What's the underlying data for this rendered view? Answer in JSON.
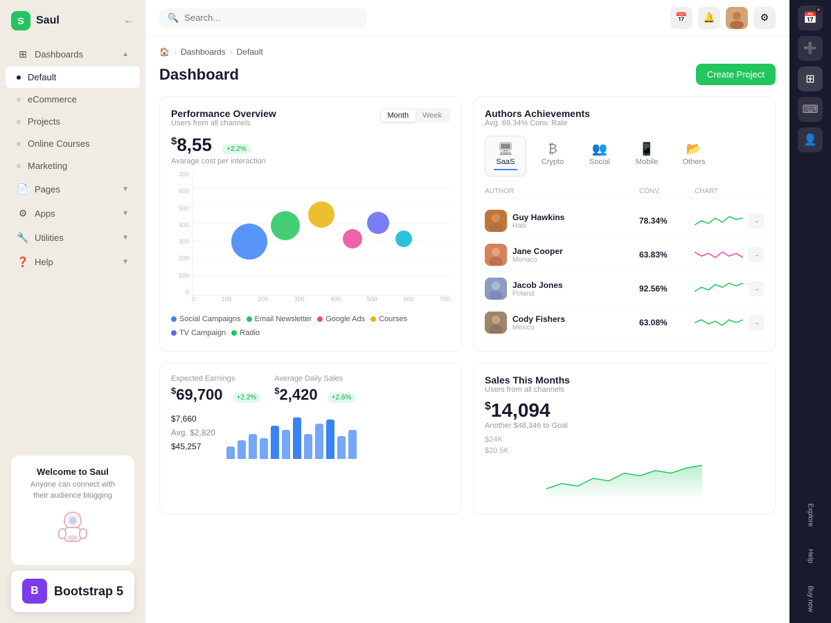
{
  "app": {
    "name": "Saul",
    "logo_initial": "S"
  },
  "topbar": {
    "search_placeholder": "Search...",
    "create_btn": "Create Project"
  },
  "breadcrumb": {
    "home": "🏠",
    "items": [
      "Dashboards",
      "Default"
    ]
  },
  "page": {
    "title": "Dashboard"
  },
  "sidebar": {
    "nav_items": [
      {
        "id": "dashboards",
        "label": "Dashboards",
        "icon": "⊞",
        "has_arrow": true,
        "active": false
      },
      {
        "id": "default",
        "label": "Default",
        "active": true,
        "is_sub": true
      },
      {
        "id": "ecommerce",
        "label": "eCommerce",
        "active": false,
        "is_sub": true
      },
      {
        "id": "projects",
        "label": "Projects",
        "active": false,
        "is_sub": true
      },
      {
        "id": "online-courses",
        "label": "Online Courses",
        "active": false,
        "is_sub": true
      },
      {
        "id": "marketing",
        "label": "Marketing",
        "active": false,
        "is_sub": true
      },
      {
        "id": "pages",
        "label": "Pages",
        "icon": "📄",
        "has_arrow": true
      },
      {
        "id": "apps",
        "label": "Apps",
        "icon": "⚙",
        "has_arrow": true
      },
      {
        "id": "utilities",
        "label": "Utilities",
        "icon": "🔧",
        "has_arrow": true
      },
      {
        "id": "help",
        "label": "Help",
        "icon": "❓",
        "has_arrow": true
      }
    ],
    "footer": {
      "welcome_title": "Welcome to Saul",
      "welcome_subtitle": "Anyone can connect with their audience blogging"
    }
  },
  "performance": {
    "title": "Performance Overview",
    "subtitle": "Users from all channels",
    "toggle": {
      "month": "Month",
      "week": "Week",
      "active": "Month"
    },
    "metric_value": "8,55",
    "metric_prefix": "$",
    "metric_badge": "+2.2%",
    "metric_label": "Avarage cost per interaction",
    "yaxis": [
      "700",
      "600",
      "500",
      "400",
      "300",
      "200",
      "100",
      "0"
    ],
    "xaxis": [
      "0",
      "100",
      "200",
      "300",
      "400",
      "500",
      "600",
      "700"
    ],
    "bubbles": [
      {
        "x": 22,
        "y": 57,
        "size": 52,
        "color": "#3b82f6"
      },
      {
        "x": 36,
        "y": 44,
        "size": 42,
        "color": "#22c55e"
      },
      {
        "x": 50,
        "y": 35,
        "size": 38,
        "color": "#eab308"
      },
      {
        "x": 62,
        "y": 55,
        "size": 28,
        "color": "#ec4899"
      },
      {
        "x": 72,
        "y": 42,
        "size": 32,
        "color": "#6366f1"
      },
      {
        "x": 82,
        "y": 55,
        "size": 24,
        "color": "#06b6d4"
      }
    ],
    "legend": [
      {
        "label": "Social Campaigns",
        "color": "#3b82f6"
      },
      {
        "label": "Email Newsletter",
        "color": "#22c55e"
      },
      {
        "label": "Google Ads",
        "color": "#ec4899"
      },
      {
        "label": "Courses",
        "color": "#eab308"
      },
      {
        "label": "TV Campaign",
        "color": "#6366f1"
      },
      {
        "label": "Radio",
        "color": "#22c55e"
      }
    ]
  },
  "authors": {
    "title": "Authors Achievements",
    "subtitle": "Avg. 69.34% Conv. Rate",
    "categories": [
      {
        "id": "saas",
        "label": "SaaS",
        "icon": "🖥",
        "active": true
      },
      {
        "id": "crypto",
        "label": "Crypto",
        "icon": "₿",
        "active": false
      },
      {
        "id": "social",
        "label": "Social",
        "icon": "👥",
        "active": false
      },
      {
        "id": "mobile",
        "label": "Mobile",
        "icon": "📱",
        "active": false
      },
      {
        "id": "others",
        "label": "Others",
        "icon": "📂",
        "active": false
      }
    ],
    "table_headers": {
      "author": "AUTHOR",
      "conv": "CONV.",
      "chart": "CHART"
    },
    "rows": [
      {
        "name": "Guy Hawkins",
        "location": "Haiti",
        "conv": "78.34%",
        "avatar_color": "#c0783a",
        "chart_color": "#22c55e"
      },
      {
        "name": "Jane Cooper",
        "location": "Monaco",
        "conv": "63.83%",
        "avatar_color": "#d4845a",
        "chart_color": "#ec4899"
      },
      {
        "name": "Jacob Jones",
        "location": "Poland",
        "conv": "92.56%",
        "avatar_color": "#8b9dc3",
        "chart_color": "#22c55e"
      },
      {
        "name": "Cody Fishers",
        "location": "Mexico",
        "conv": "63.08%",
        "avatar_color": "#a0856b",
        "chart_color": "#22c55e"
      }
    ],
    "view_btn_label": "→"
  },
  "earnings": {
    "title": "Expected Earnings",
    "value": "69,700",
    "prefix": "$",
    "badge": "+2.2%",
    "daily_title": "Average Daily Sales",
    "daily_value": "2,420",
    "daily_badge": "+2.6%",
    "rows": [
      {
        "label": "",
        "value": "$7,660"
      },
      {
        "label": "Avg.",
        "value": "$2,820"
      },
      {
        "label": "",
        "value": "$45,257"
      }
    ],
    "bars": [
      4,
      6,
      8,
      7,
      10,
      9,
      12,
      8,
      11,
      13,
      7,
      9
    ]
  },
  "sales": {
    "title": "Sales This Months",
    "subtitle": "Users from all channels",
    "value": "14,094",
    "prefix": "$",
    "goal_text": "Another $48,346 to Goal",
    "y_labels": [
      "$24K",
      "$20.5K"
    ]
  },
  "right_panel": {
    "icons": [
      "📅",
      "🔔",
      "👤",
      "⚙"
    ],
    "labels": [
      "Explore",
      "Help",
      "Buy now"
    ]
  },
  "bootstrap_badge": {
    "icon_text": "B",
    "label": "Bootstrap 5"
  }
}
